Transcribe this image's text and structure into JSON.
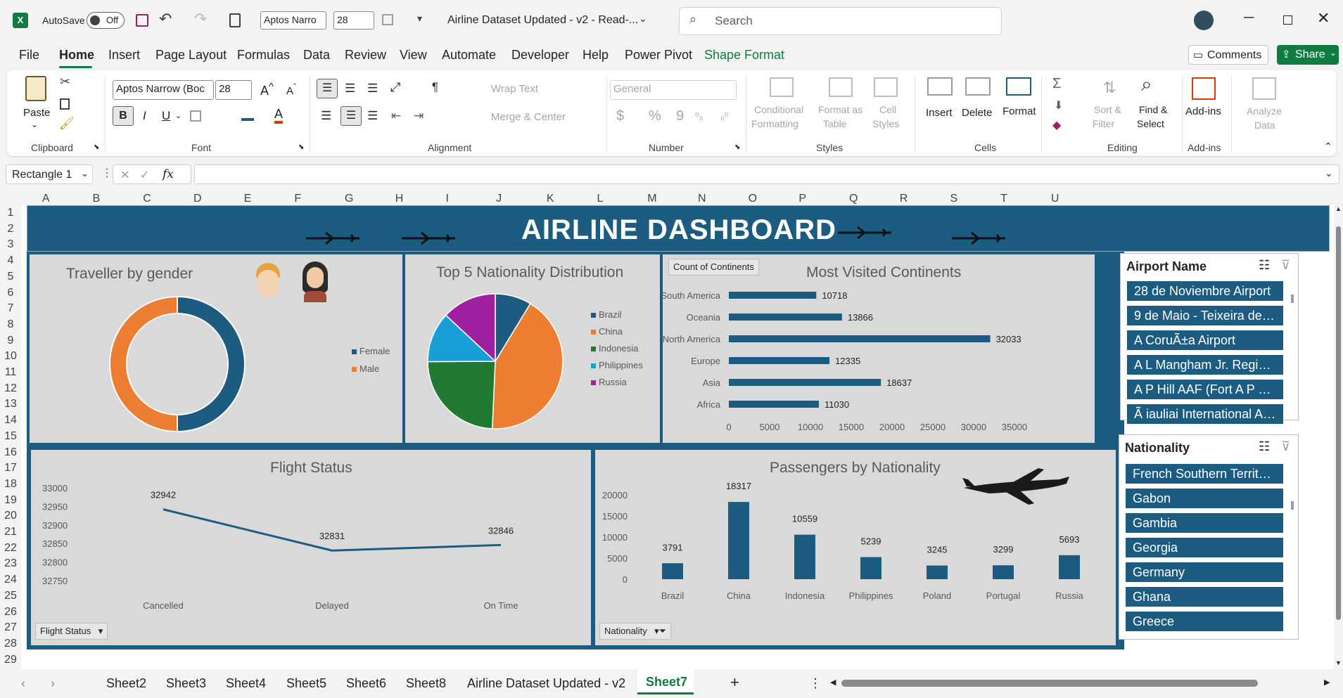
{
  "titlebar": {
    "autosave_label": "AutoSave",
    "autosave_state": "Off",
    "font_name": "Aptos Narro",
    "font_size": "28",
    "doc_title": "Airline Dataset Updated - v2  -  Read-...",
    "search_placeholder": "Search"
  },
  "menu": {
    "tabs": [
      "File",
      "Home",
      "Insert",
      "Page Layout",
      "Formulas",
      "Data",
      "Review",
      "View",
      "Automate",
      "Developer",
      "Help",
      "Power Pivot",
      "Shape Format"
    ],
    "active": "Home",
    "comments_label": "Comments",
    "share_label": "Share"
  },
  "ribbon": {
    "clipboard": {
      "paste": "Paste",
      "group": "Clipboard"
    },
    "font": {
      "name": "Aptos Narrow (Boc",
      "size": "28",
      "bold": "B",
      "italic": "I",
      "underline": "U",
      "group": "Font"
    },
    "alignment": {
      "wrap_text": "Wrap Text",
      "merge_center": "Merge & Center",
      "group": "Alignment"
    },
    "number": {
      "format": "General",
      "currency": "$",
      "percent": "%",
      "comma": "9",
      "group": "Number"
    },
    "styles": {
      "conditional": "Conditional",
      "formatting": "Formatting",
      "format_as": "Format as",
      "table": "Table",
      "cell": "Cell",
      "cell_styles": "Styles",
      "group": "Styles"
    },
    "cells": {
      "insert": "Insert",
      "delete": "Delete",
      "format": "Format",
      "group": "Cells"
    },
    "editing": {
      "sort": "Sort &",
      "filter": "Filter",
      "find": "Find &",
      "select": "Select",
      "group": "Editing"
    },
    "addins": {
      "label": "Add-ins",
      "group": "Add-ins"
    },
    "analyze": {
      "line1": "Analyze",
      "line2": "Data"
    }
  },
  "formula_bar": {
    "name_box": "Rectangle 1",
    "fx": "fx",
    "formula": ""
  },
  "columns": [
    "A",
    "B",
    "C",
    "D",
    "E",
    "F",
    "G",
    "H",
    "I",
    "J",
    "K",
    "L",
    "M",
    "N",
    "O",
    "P",
    "Q",
    "R",
    "S",
    "T",
    "U"
  ],
  "rows": [
    "1",
    "2",
    "3",
    "4",
    "5",
    "6",
    "7",
    "8",
    "9",
    "10",
    "11",
    "12",
    "13",
    "14",
    "15",
    "16",
    "17",
    "18",
    "19",
    "20",
    "21",
    "22",
    "23",
    "24",
    "25",
    "26",
    "27",
    "28",
    "29"
  ],
  "dashboard": {
    "title": "AIRLINE DASHBOARD",
    "colors": {
      "navy": "#1c5c80",
      "orange": "#ed7d31",
      "green": "#217a31",
      "cyan": "#17a0d8",
      "purple": "#a0219f",
      "panel": "#d9d9d9"
    }
  },
  "chart_data": [
    {
      "type": "pie",
      "title": "Traveller by gender",
      "categories": [
        "Female",
        "Male"
      ],
      "values": [
        50,
        50
      ],
      "colors": [
        "#1c5c80",
        "#ed7d31"
      ],
      "legend": "right"
    },
    {
      "type": "pie",
      "title": "Top 5 Nationality Distribution",
      "categories": [
        "Brazil",
        "China",
        "Indonesia",
        "Philippines",
        "Russia"
      ],
      "values": [
        3791,
        18317,
        10559,
        5239,
        5693
      ],
      "colors": [
        "#1c5c80",
        "#ed7d31",
        "#217a31",
        "#17a0d8",
        "#a0219f"
      ],
      "legend": "right"
    },
    {
      "type": "bar",
      "orientation": "horizontal",
      "title": "Most Visited Continents",
      "field_button": "Count of Continents",
      "categories": [
        "South America",
        "Oceania",
        "North America",
        "Europe",
        "Asia",
        "Africa"
      ],
      "values": [
        10718,
        13866,
        32033,
        12335,
        18637,
        11030
      ],
      "xticks": [
        "0",
        "5000",
        "10000",
        "15000",
        "20000",
        "25000",
        "30000",
        "35000"
      ],
      "xlim": [
        0,
        35000
      ]
    },
    {
      "type": "line",
      "title": "Flight Status",
      "field_button": "Flight Status",
      "categories": [
        "Cancelled",
        "Delayed",
        "On Time"
      ],
      "values": [
        32942,
        32831,
        32846
      ],
      "yticks": [
        "33000",
        "32950",
        "32900",
        "32850",
        "32800",
        "32750"
      ],
      "ylim": [
        32750,
        33000
      ]
    },
    {
      "type": "bar",
      "title": "Passengers by Nationality",
      "field_button": "Nationality",
      "categories": [
        "Brazil",
        "China",
        "Indonesia",
        "Philippines",
        "Poland",
        "Portugal",
        "Russia"
      ],
      "values": [
        3791,
        18317,
        10559,
        5239,
        3245,
        3299,
        5693
      ],
      "yticks": [
        "20000",
        "15000",
        "10000",
        "5000",
        "0"
      ],
      "ylim": [
        0,
        20000
      ]
    }
  ],
  "slicers": {
    "airport": {
      "title": "Airport Name",
      "items": [
        "28 de Noviembre Airport",
        "9 de Maio - Teixeira de Fr...",
        "A CoruÃ±a Airport",
        "A L Mangham Jr. Regional...",
        "A P Hill AAF (Fort A P Hill)...",
        "Ã iauliai International Airport"
      ]
    },
    "nationality": {
      "title": "Nationality",
      "items": [
        "French Southern Territories",
        "Gabon",
        "Gambia",
        "Georgia",
        "Germany",
        "Ghana",
        "Greece"
      ]
    }
  },
  "sheet_tabs": {
    "items": [
      "Sheet2",
      "Sheet3",
      "Sheet4",
      "Sheet5",
      "Sheet6",
      "Sheet8",
      "Airline Dataset Updated - v2",
      "Sheet7"
    ],
    "active": "Sheet7"
  }
}
